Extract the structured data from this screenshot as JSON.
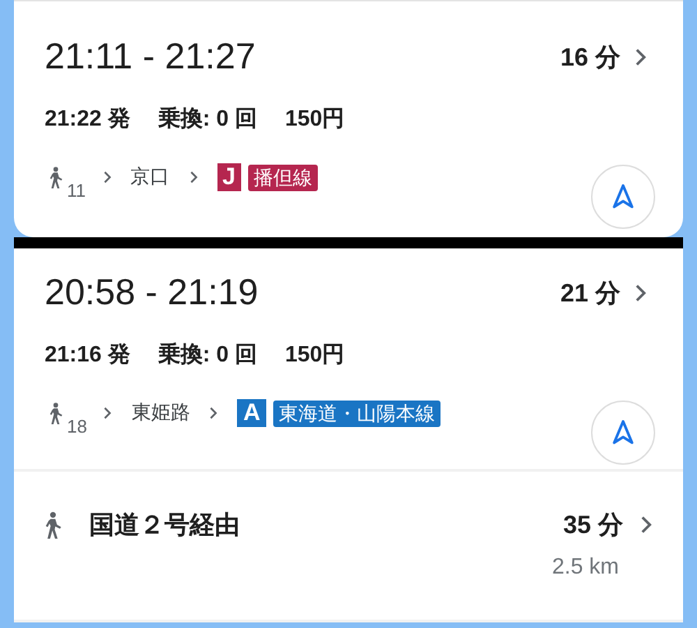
{
  "routes": [
    {
      "time_range": "21:11 - 21:27",
      "duration": "16 分",
      "departure": "21:22 発",
      "transfers": "乗換: 0 回",
      "fare": "150円",
      "walk_minutes": "11",
      "station": "京口",
      "line_code": "J",
      "line_name": "播但線",
      "color": "#b5264f"
    },
    {
      "time_range": "20:58 - 21:19",
      "duration": "21 分",
      "departure": "21:16 発",
      "transfers": "乗換: 0 回",
      "fare": "150円",
      "walk_minutes": "18",
      "station": "東姫路",
      "line_code": "A",
      "line_name": "東海道・山陽本線",
      "color": "#1a75c4"
    }
  ],
  "walking": {
    "route": "国道２号経由",
    "duration": "35 分",
    "distance": "2.5 km"
  }
}
